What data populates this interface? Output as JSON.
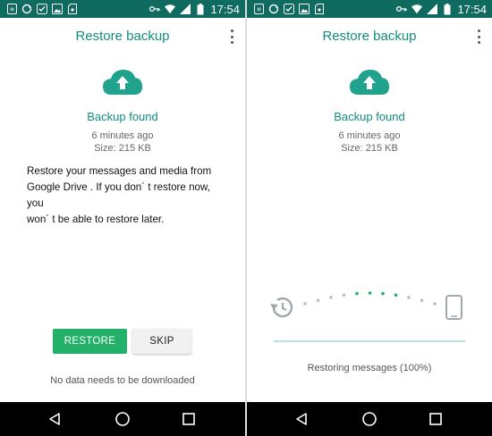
{
  "status_bar": {
    "time": "17:54",
    "left_icons": [
      "sim-icon",
      "sync-icon",
      "whatsapp-status-icon",
      "image-icon",
      "sd-card-icon"
    ],
    "right_icons": [
      "key-icon",
      "wifi-icon",
      "signal-icon",
      "battery-icon"
    ]
  },
  "colors": {
    "status_bar": "#0f6a5f",
    "accent": "#128c7e",
    "cloud": "#21a28d",
    "restore_button": "#23b169",
    "dot_active": "#23b169",
    "dot_inactive": "#bdbdbd",
    "icon_gray": "#a0a8ad"
  },
  "left_screen": {
    "title": "Restore backup",
    "menu_icon": "more-vertical-icon",
    "cloud_icon": "cloud-upload-icon",
    "backup_found": "Backup found",
    "backup_age": "6 minutes ago",
    "backup_size": "Size: 215 KB",
    "message_line1": "Restore your messages and media from",
    "message_line2": "Google Drive . If you don´ t restore now, you",
    "message_line3": "won´ t be able to restore later.",
    "restore_button": "RESTORE",
    "skip_button": "SKIP",
    "footnote": "No data needs to be downloaded"
  },
  "right_screen": {
    "title": "Restore backup",
    "menu_icon": "more-vertical-icon",
    "cloud_icon": "cloud-upload-icon",
    "backup_found": "Backup found",
    "backup_age": "6 minutes ago",
    "backup_size": "Size: 215 KB",
    "animation": {
      "from_icon": "history-icon",
      "to_icon": "phone-icon",
      "dot_count": 11,
      "active_dots": [
        4,
        5,
        6,
        7
      ]
    },
    "progress": 1.0,
    "status_text": "Restoring messages (100%)"
  },
  "nav_bar": {
    "icons": [
      "back-icon",
      "home-icon",
      "recents-icon"
    ]
  }
}
